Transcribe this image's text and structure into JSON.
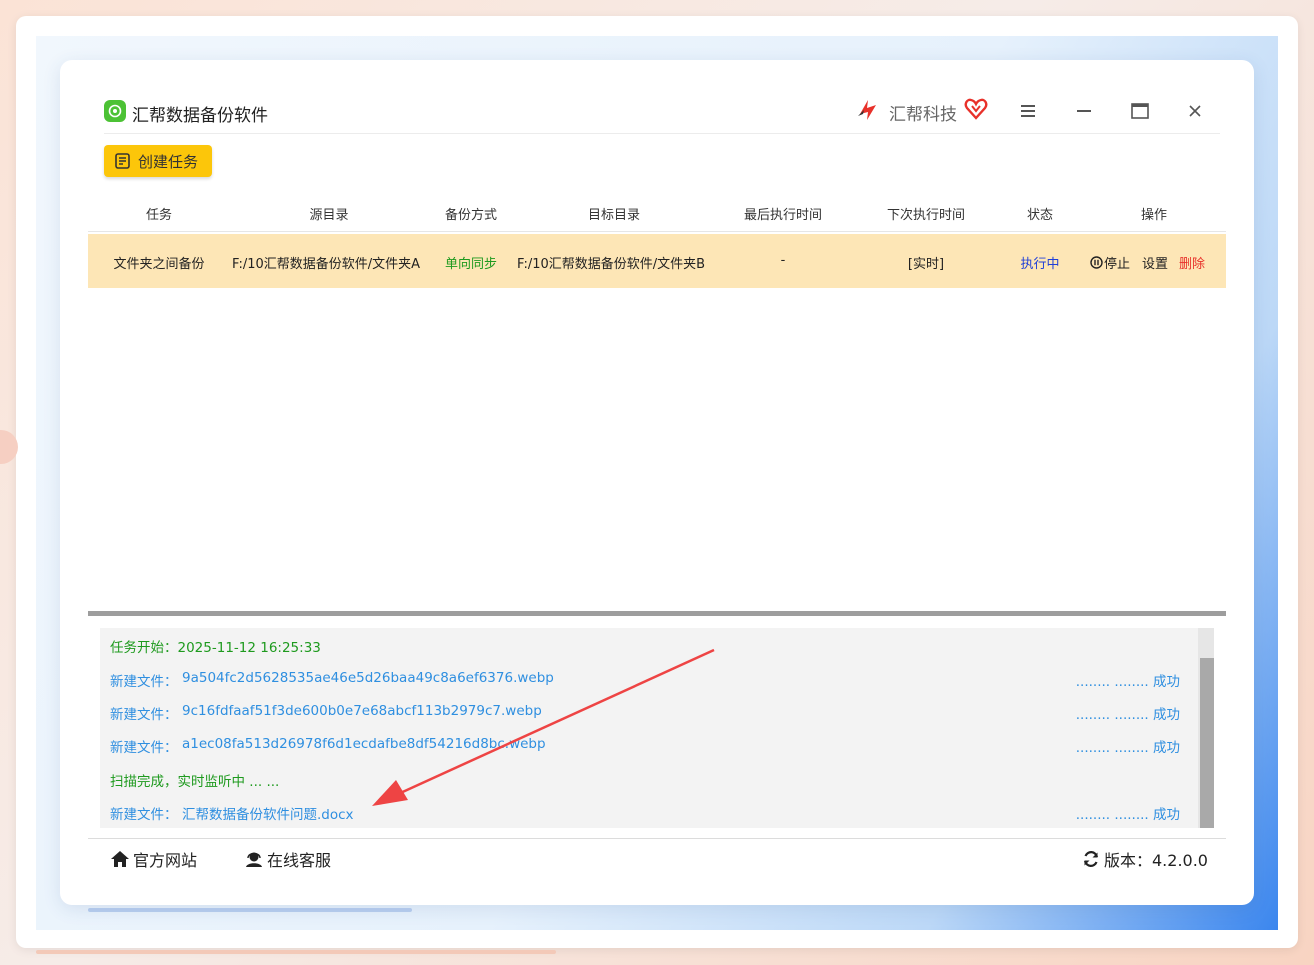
{
  "app": {
    "title": "汇帮数据备份软件",
    "brand": "汇帮科技",
    "create_task_label": "创建任务"
  },
  "table": {
    "headers": [
      "任务",
      "源目录",
      "备份方式",
      "目标目录",
      "最后执行时间",
      "下次执行时间",
      "状态",
      "操作"
    ],
    "rows": [
      {
        "task": "文件夹之间备份",
        "source": "F:/10汇帮数据备份软件/文件夹A",
        "mode": "单向同步",
        "target": "F:/10汇帮数据备份软件/文件夹B",
        "last_run": "-",
        "next_run": "[实时]",
        "status": "执行中",
        "action_stop": "停止",
        "action_settings": "设置",
        "action_delete": "删除"
      }
    ]
  },
  "log": {
    "start": "任务开始：2025-11-12 16:25:33",
    "new_file_label": "新建文件：",
    "files": [
      "9a504fc2d5628535ae46e5d26baa49c8a6ef6376.webp",
      "9c16fdfaaf51f3de600b0e7e68abcf113b2979c7.webp",
      "a1ec08fa513d26978f6d1ecdafbe8df54216d8bc.webp"
    ],
    "scan_done": "扫描完成，实时监听中 ... ...",
    "last_file": "汇帮数据备份软件问题.docx",
    "status_text": "........ ........ 成功"
  },
  "footer": {
    "website": "官方网站",
    "support": "在线客服",
    "version": "版本：4.2.0.0"
  },
  "colors": {
    "accent_yellow": "#fcc60a",
    "row_highlight": "#fde6b6",
    "status_blue": "#1f3fd8",
    "mode_green": "#1e9a1e",
    "delete_red": "#e8312a",
    "arrow_red": "#ee4444"
  }
}
